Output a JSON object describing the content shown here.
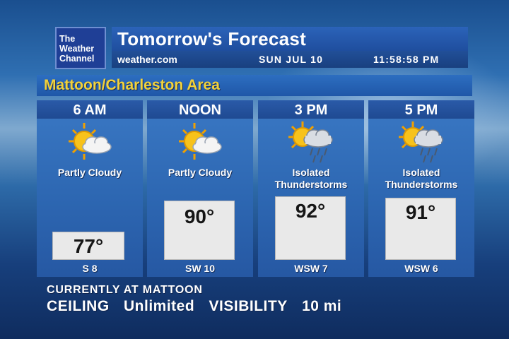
{
  "logo": {
    "line1": "The",
    "line2": "Weather",
    "line3": "Channel"
  },
  "header": {
    "title": "Tomorrow's Forecast",
    "site": "weather.com",
    "date": "SUN JUL 10",
    "time": "11:58:58 PM"
  },
  "area": "Mattoon/Charleston Area",
  "periods": [
    {
      "time": "6 AM",
      "icon": "partly-cloudy-icon",
      "cond1": "Partly Cloudy",
      "cond2": "",
      "temp": "77°",
      "wind": "S 8"
    },
    {
      "time": "NOON",
      "icon": "partly-cloudy-icon",
      "cond1": "Partly Cloudy",
      "cond2": "",
      "temp": "90°",
      "wind": "SW 10"
    },
    {
      "time": "3 PM",
      "icon": "thunderstorm-icon",
      "cond1": "Isolated",
      "cond2": "Thunderstorms",
      "temp": "92°",
      "wind": "WSW 7"
    },
    {
      "time": "5 PM",
      "icon": "thunderstorm-icon",
      "cond1": "Isolated",
      "cond2": "Thunderstorms",
      "temp": "91°",
      "wind": "WSW 6"
    }
  ],
  "current": {
    "heading": "CURRENTLY AT MATTOON",
    "ceiling_label": "CEILING",
    "ceiling_value": "Unlimited",
    "visibility_label": "VISIBILITY",
    "visibility_value": "10 mi"
  },
  "colors": {
    "area_text": "#f2d23a",
    "panel": "#2d67b2",
    "temp_box": "#e9e9e9"
  }
}
